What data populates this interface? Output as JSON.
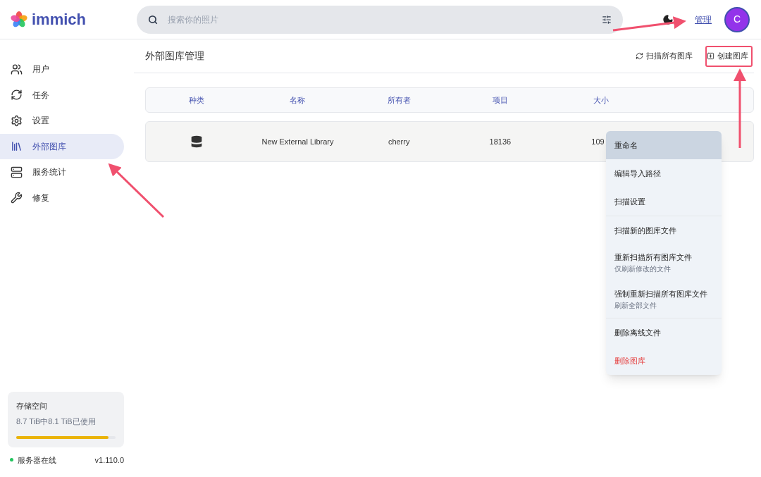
{
  "header": {
    "logo_text": "immich",
    "search": {
      "placeholder": "搜索你的照片"
    },
    "admin_link": "管理",
    "avatar_letter": "C"
  },
  "sidebar": {
    "items": [
      {
        "label": "用户",
        "selected": false
      },
      {
        "label": "任务",
        "selected": false
      },
      {
        "label": "设置",
        "selected": false
      },
      {
        "label": "外部图库",
        "selected": true
      },
      {
        "label": "服务统计",
        "selected": false
      },
      {
        "label": "修复",
        "selected": false
      }
    ],
    "storage": {
      "title": "存储空间",
      "usage": "8.7 TiB中8.1 TiB已使用",
      "level": 0.93
    },
    "server_status": {
      "label": "服务器在线",
      "online": true,
      "version": "v1.110.0"
    }
  },
  "page": {
    "title": "外部图库管理",
    "actions": [
      "扫描所有图库",
      "创建图库"
    ]
  },
  "table": {
    "columns": [
      "种类",
      "名称",
      "所有者",
      "项目",
      "大小"
    ],
    "rows": [
      {
        "name": "New External Library",
        "owner": "cherry",
        "items": "18136",
        "size": "109"
      }
    ]
  },
  "context_menu": {
    "sections": [
      [
        {
          "label": "重命名",
          "selected": true,
          "kind": "action"
        },
        {
          "label": "编辑导入路径",
          "selected": false,
          "kind": "action"
        },
        {
          "label": "扫描设置",
          "selected": false,
          "kind": "action"
        }
      ],
      [
        {
          "label": "扫描新的图库文件",
          "selected": false,
          "kind": "action"
        },
        {
          "label": "重新扫描所有图库文件",
          "subtitle": "仅刷新修改的文件",
          "selected": false,
          "kind": "action"
        },
        {
          "label": "强制重新扫描所有图库文件",
          "subtitle": "刷新全部文件",
          "selected": false,
          "kind": "action"
        }
      ],
      [
        {
          "label": "删除离线文件",
          "selected": false,
          "kind": "action"
        },
        {
          "label": "删除图库",
          "selected": false,
          "kind": "danger"
        }
      ]
    ]
  }
}
